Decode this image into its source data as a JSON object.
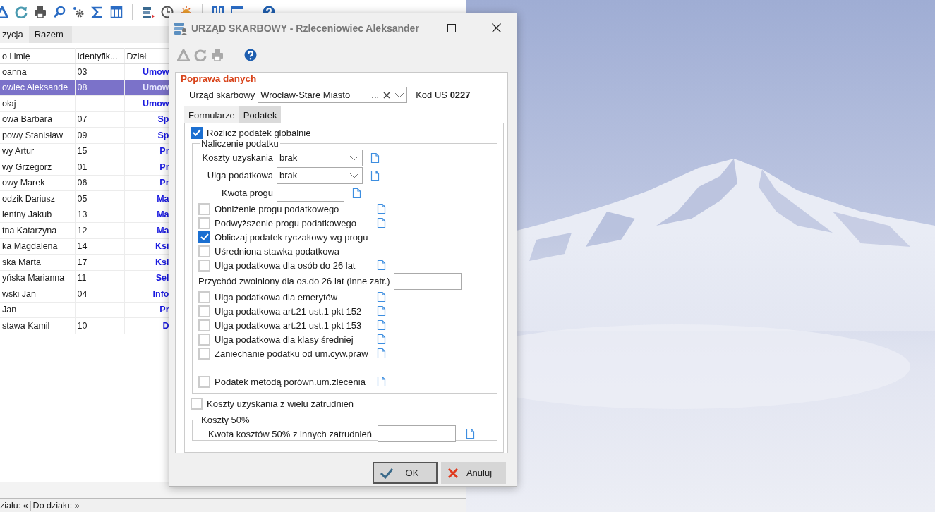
{
  "main_window": {
    "tabs": [
      {
        "label": "zycja",
        "selected": false
      },
      {
        "label": "Razem",
        "selected": true
      }
    ],
    "table": {
      "columns": [
        "o i imię",
        "Identyfik...",
        "Dział"
      ],
      "rows": [
        {
          "cells": [
            "oanna",
            "03",
            "Umow"
          ],
          "selected": false
        },
        {
          "cells": [
            "owiec Aleksande",
            "08",
            "Umow"
          ],
          "selected": true
        },
        {
          "cells": [
            "ołaj",
            "",
            "Umow"
          ],
          "selected": false
        },
        {
          "cells": [
            "owa Barbara",
            "07",
            "Sp"
          ],
          "selected": false
        },
        {
          "cells": [
            "powy Stanisław",
            "09",
            "Sp"
          ],
          "selected": false
        },
        {
          "cells": [
            "wy Artur",
            "15",
            "Pr"
          ],
          "selected": false
        },
        {
          "cells": [
            "wy Grzegorz",
            "01",
            "Pr"
          ],
          "selected": false
        },
        {
          "cells": [
            "owy Marek",
            "06",
            "Pr"
          ],
          "selected": false
        },
        {
          "cells": [
            "odzik Dariusz",
            "05",
            "Ma"
          ],
          "selected": false
        },
        {
          "cells": [
            "lentny Jakub",
            "13",
            "Ma"
          ],
          "selected": false
        },
        {
          "cells": [
            "tna Katarzyna",
            "12",
            "Ma"
          ],
          "selected": false
        },
        {
          "cells": [
            "ka Magdalena",
            "14",
            "Ksi"
          ],
          "selected": false
        },
        {
          "cells": [
            "ska Marta",
            "17",
            "Ksi"
          ],
          "selected": false
        },
        {
          "cells": [
            "yńska Marianna",
            "11",
            "Sel"
          ],
          "selected": false
        },
        {
          "cells": [
            "wski Jan",
            "04",
            "Info"
          ],
          "selected": false
        },
        {
          "cells": [
            "Jan",
            "",
            "Pr"
          ],
          "selected": false
        },
        {
          "cells": [
            "stawa Kamil",
            "10",
            "D"
          ],
          "selected": false
        }
      ]
    },
    "status_bar": [
      "ziału: «",
      "Do działu: »"
    ]
  },
  "dialog": {
    "title": "URZĄD SKARBOWY - Rzleceniowiec Aleksander",
    "section_title": "Poprawa danych",
    "office": {
      "label": "Urząd skarbowy",
      "value": "Wrocław-Stare Miasto",
      "more": "...",
      "code": "Kod US **0227**"
    },
    "tabs": [
      {
        "label": "Formularze",
        "selected": false
      },
      {
        "label": "Podatek",
        "selected": true
      }
    ],
    "global": {
      "label": "Rozlicz podatek globalnie",
      "checked": true
    },
    "group": {
      "title": "Naliczenie podatku",
      "rows": [
        {
          "kind": "select",
          "label": "Koszty uzyskania",
          "value": "brak",
          "doc": true
        },
        {
          "kind": "select",
          "label": "Ulga podatkowa",
          "value": "brak",
          "doc": true
        },
        {
          "kind": "input",
          "label": "Kwota progu",
          "doc": true
        },
        {
          "kind": "check",
          "label": "Obniżenie progu podatkowego",
          "checked": false,
          "doc": true
        },
        {
          "kind": "check",
          "label": "Podwyższenie progu podatkowego",
          "checked": false,
          "doc": true
        },
        {
          "kind": "check",
          "label": "Obliczaj podatek ryczałtowy wg progu",
          "checked": true,
          "doc": false
        },
        {
          "kind": "check",
          "label": "Uśredniona stawka podatkowa",
          "checked": false,
          "doc": false
        },
        {
          "kind": "check",
          "label": "Ulga podatkowa dla osób do 26 lat",
          "checked": false,
          "doc": true
        },
        {
          "kind": "wide_input",
          "label": "Przychód zwolniony dla os.do 26 lat (inne zatr.)",
          "doc": false
        },
        {
          "kind": "check",
          "label": "Ulga podatkowa dla emerytów",
          "checked": false,
          "doc": true
        },
        {
          "kind": "check",
          "label": "Ulga podatkowa art.21 ust.1 pkt 152",
          "checked": false,
          "doc": true
        },
        {
          "kind": "check",
          "label": "Ulga podatkowa art.21 ust.1 pkt 153",
          "checked": false,
          "doc": true
        },
        {
          "kind": "check",
          "label": "Ulga podatkowa dla klasy średniej",
          "checked": false,
          "doc": true
        },
        {
          "kind": "check",
          "label": "Zaniechanie podatku od um.cyw.praw",
          "checked": false,
          "doc": true
        },
        {
          "kind": "spacer"
        },
        {
          "kind": "check",
          "label": "Podatek metodą porówn.um.zlecenia",
          "checked": false,
          "doc": true
        }
      ]
    },
    "multi": {
      "label": "Koszty uzyskania z wielu zatrudnień",
      "checked": false
    },
    "group2": {
      "title": "Koszty 50%",
      "field_label": "Kwota kosztów 50% z innych zatrudnień"
    },
    "buttons": [
      {
        "kind": "ok",
        "label": "OK"
      },
      {
        "kind": "cancel",
        "label": "Anuluj"
      }
    ]
  }
}
